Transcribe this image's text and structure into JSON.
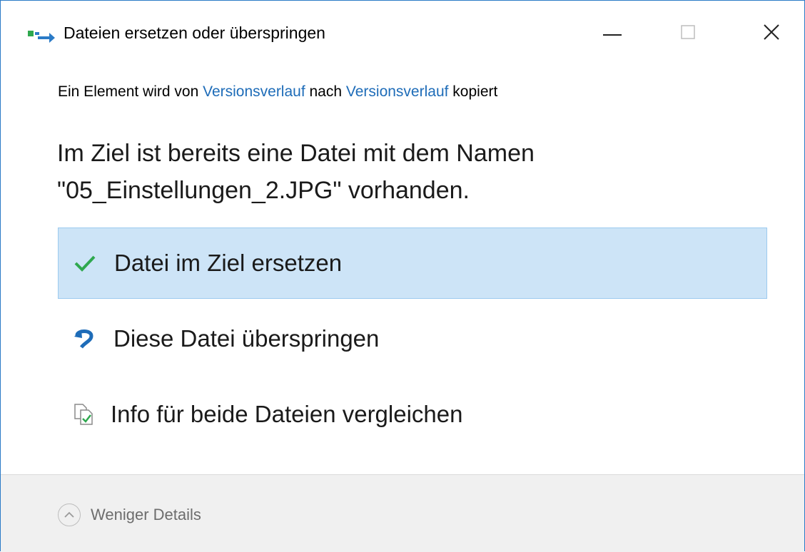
{
  "window": {
    "title": "Dateien ersetzen oder überspringen",
    "icons": {
      "app": "file-move-icon",
      "minimize": "minimize-icon",
      "maximize": "maximize-icon",
      "close": "close-icon"
    }
  },
  "info": {
    "prefix": "Ein Element wird von ",
    "source": "Versionsverlauf",
    "middle": " nach ",
    "destination": "Versionsverlauf",
    "suffix": " kopiert"
  },
  "message": {
    "line1": "Im Ziel ist bereits eine Datei mit dem Namen",
    "line2": "\"05_Einstellungen_2.JPG\" vorhanden."
  },
  "options": [
    {
      "label": "Datei im Ziel ersetzen",
      "icon": "checkmark-icon",
      "selected": true
    },
    {
      "label": "Diese Datei überspringen",
      "icon": "skip-arrow-icon",
      "selected": false
    },
    {
      "label": "Info für beide Dateien vergleichen",
      "icon": "compare-files-icon",
      "selected": false
    }
  ],
  "footer": {
    "details_label": "Weniger Details",
    "icon": "chevron-up-circle-icon"
  },
  "colors": {
    "link": "#1e6cb8",
    "selection_bg": "#cde4f7",
    "selection_border": "#9ccaef",
    "check": "#2fa84f",
    "skip": "#1e6cb8",
    "window_border": "#2b7bc7"
  }
}
